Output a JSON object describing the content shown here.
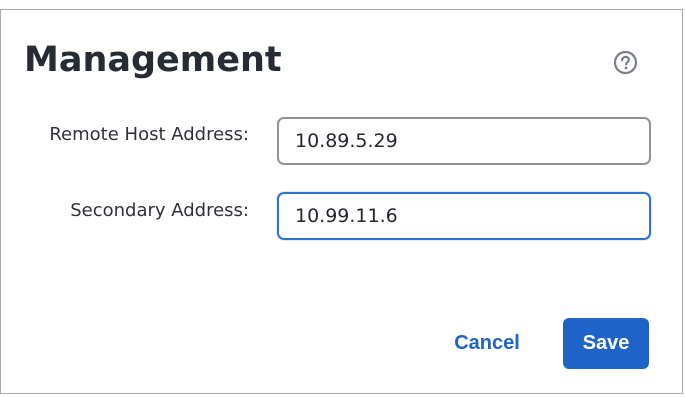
{
  "dialog": {
    "title": "Management",
    "help_icon": "question-circle-icon"
  },
  "fields": {
    "remote_host": {
      "label": "Remote Host Address:",
      "value": "10.89.5.29"
    },
    "secondary": {
      "label": "Secondary Address:",
      "value": "10.99.11.6"
    }
  },
  "buttons": {
    "cancel_label": "Cancel",
    "save_label": "Save"
  },
  "colors": {
    "accent": "#1e64c8",
    "title": "#272b34",
    "field_border": "#8e939a",
    "focus_border": "#2f73d6"
  }
}
